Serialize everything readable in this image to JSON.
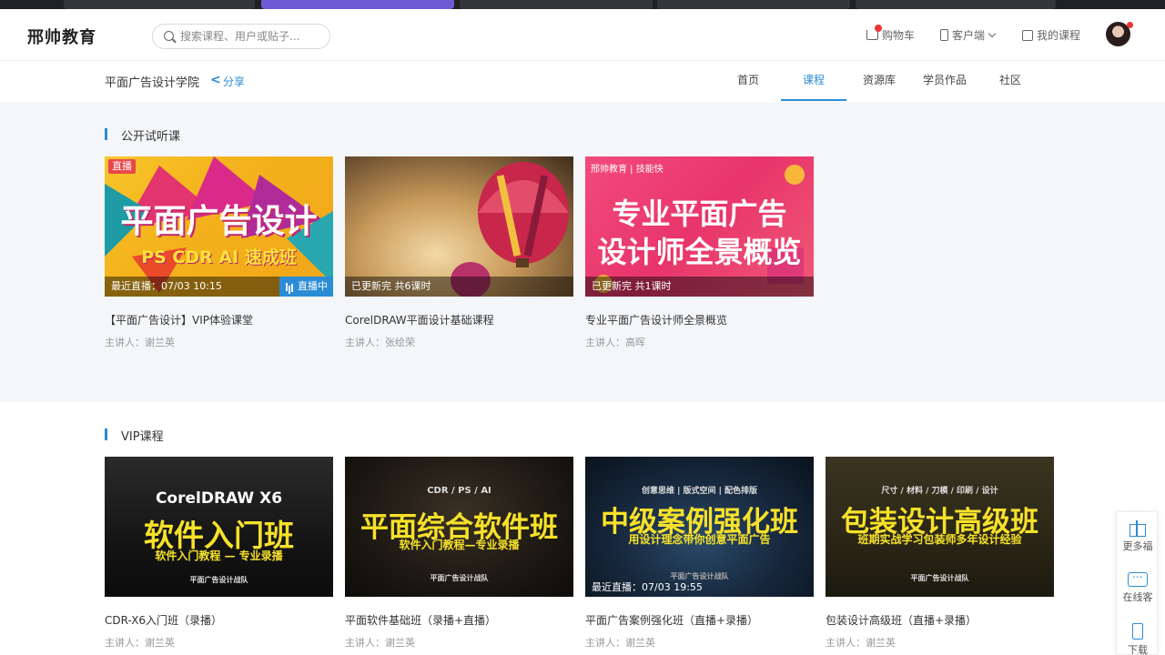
{
  "header": {
    "logo": "邢帅教育",
    "search_placeholder": "搜索课程、用户或贴子...",
    "cart": "购物车",
    "client": "客户端",
    "my_courses": "我的课程"
  },
  "subbar": {
    "school": "平面广告设计学院",
    "share": "分享",
    "tabs": [
      "首页",
      "课程",
      "资源库",
      "学员作品",
      "社区"
    ],
    "active_tab": 1
  },
  "section_free": {
    "title": "公开试听课",
    "cards": [
      {
        "title": "【平面广告设计】VIP体验课堂",
        "teacher": "主讲人：谢兰英",
        "thumb_tag": "直播",
        "thumb_line1": "平面广告设计",
        "thumb_line2": "PS CDR AI 速成班",
        "status": "最近直播：07/03 10:15",
        "live_now": "直播中"
      },
      {
        "title": "CorelDRAW平面设计基础课程",
        "teacher": "主讲人：张绘荣",
        "status": "已更新完 共6课时"
      },
      {
        "title": "专业平面广告设计师全景概览",
        "teacher": "主讲人：高晖",
        "thumb_brand": "邢帅教育 | 技能快",
        "thumb_line1": "专业平面广告",
        "thumb_line2": "设计师全景概览",
        "status": "已更新完 共1课时"
      }
    ]
  },
  "section_vip": {
    "title": "VIP课程",
    "cards": [
      {
        "title": "CDR-X6入门班（录播）",
        "teacher": "主讲人：谢兰英",
        "thumb_top": "CorelDRAW X6",
        "thumb_main": "软件入门班",
        "thumb_sub": "软件入门教程 — 专业录播",
        "thumb_foot": "平面广告设计战队"
      },
      {
        "title": "平面软件基础班（录播+直播）",
        "teacher": "主讲人：谢兰英",
        "thumb_top": "CDR / PS / AI",
        "thumb_main": "平面综合软件班",
        "thumb_sub": "软件入门教程—专业录播",
        "thumb_foot": "平面广告设计战队"
      },
      {
        "title": "平面广告案例强化班（直播+录播）",
        "teacher": "主讲人：谢兰英",
        "thumb_top": "创意思维 | 版式空间 | 配色排版",
        "thumb_main": "中级案例强化班",
        "thumb_sub": "用设计理念带你创意平面广告",
        "thumb_foot": "平面广告设计战队",
        "status": "最近直播：07/03 19:55"
      },
      {
        "title": "包装设计高级班（直播+录播）",
        "teacher": "主讲人：谢兰英",
        "thumb_top": "尺寸 / 材料 / 刀模 / 印刷 / 设计",
        "thumb_main": "包装设计高级班",
        "thumb_sub": "班期实战学习包装师多年设计经验",
        "thumb_foot": "平面广告设计战队"
      }
    ]
  },
  "float_bar": {
    "more": "更多福",
    "online": "在线客",
    "download": "下载"
  }
}
